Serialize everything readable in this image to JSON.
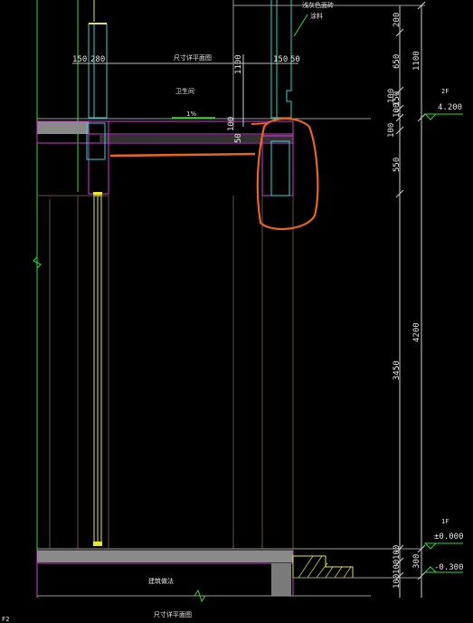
{
  "drawing": {
    "top_dims": {
      "left_a": "150",
      "left_b": "280",
      "right_a": "150",
      "right_b": "50"
    },
    "section_label_top": "尺寸详平面图",
    "section_label_bottom": "尺寸详平面图",
    "callout_label_1": "浅灰色面砖",
    "callout_label_2": "涂料",
    "slope_text": "1%",
    "room_label": "卫生间",
    "base_label": "建筑做法",
    "vertical_dims_inner": [
      "1100",
      "100",
      "50"
    ],
    "vertical_dims_right": [
      "200",
      "650",
      "100",
      "100",
      "150",
      "100",
      "550",
      "3450",
      "100",
      "100",
      "100"
    ],
    "vertical_dims_far_right": [
      "1100",
      "4200",
      "300"
    ],
    "levels": [
      {
        "floor_tag": "2F",
        "value": "4.200"
      },
      {
        "floor_tag": "1F",
        "value": "±0.000"
      },
      {
        "floor_tag": "",
        "value": "-0.300"
      }
    ],
    "footer_text": "F2"
  },
  "colors": {
    "background": "#000000",
    "wall_cyan": "#34d3d3",
    "slab_magenta": "#d23ed2",
    "window_yellow": "#e8e832",
    "axis_green": "#2fdc2f",
    "markup_orange": "#e8651e",
    "grey_fill": "#8a8a8a",
    "dim_grey": "#cfcfcf"
  }
}
